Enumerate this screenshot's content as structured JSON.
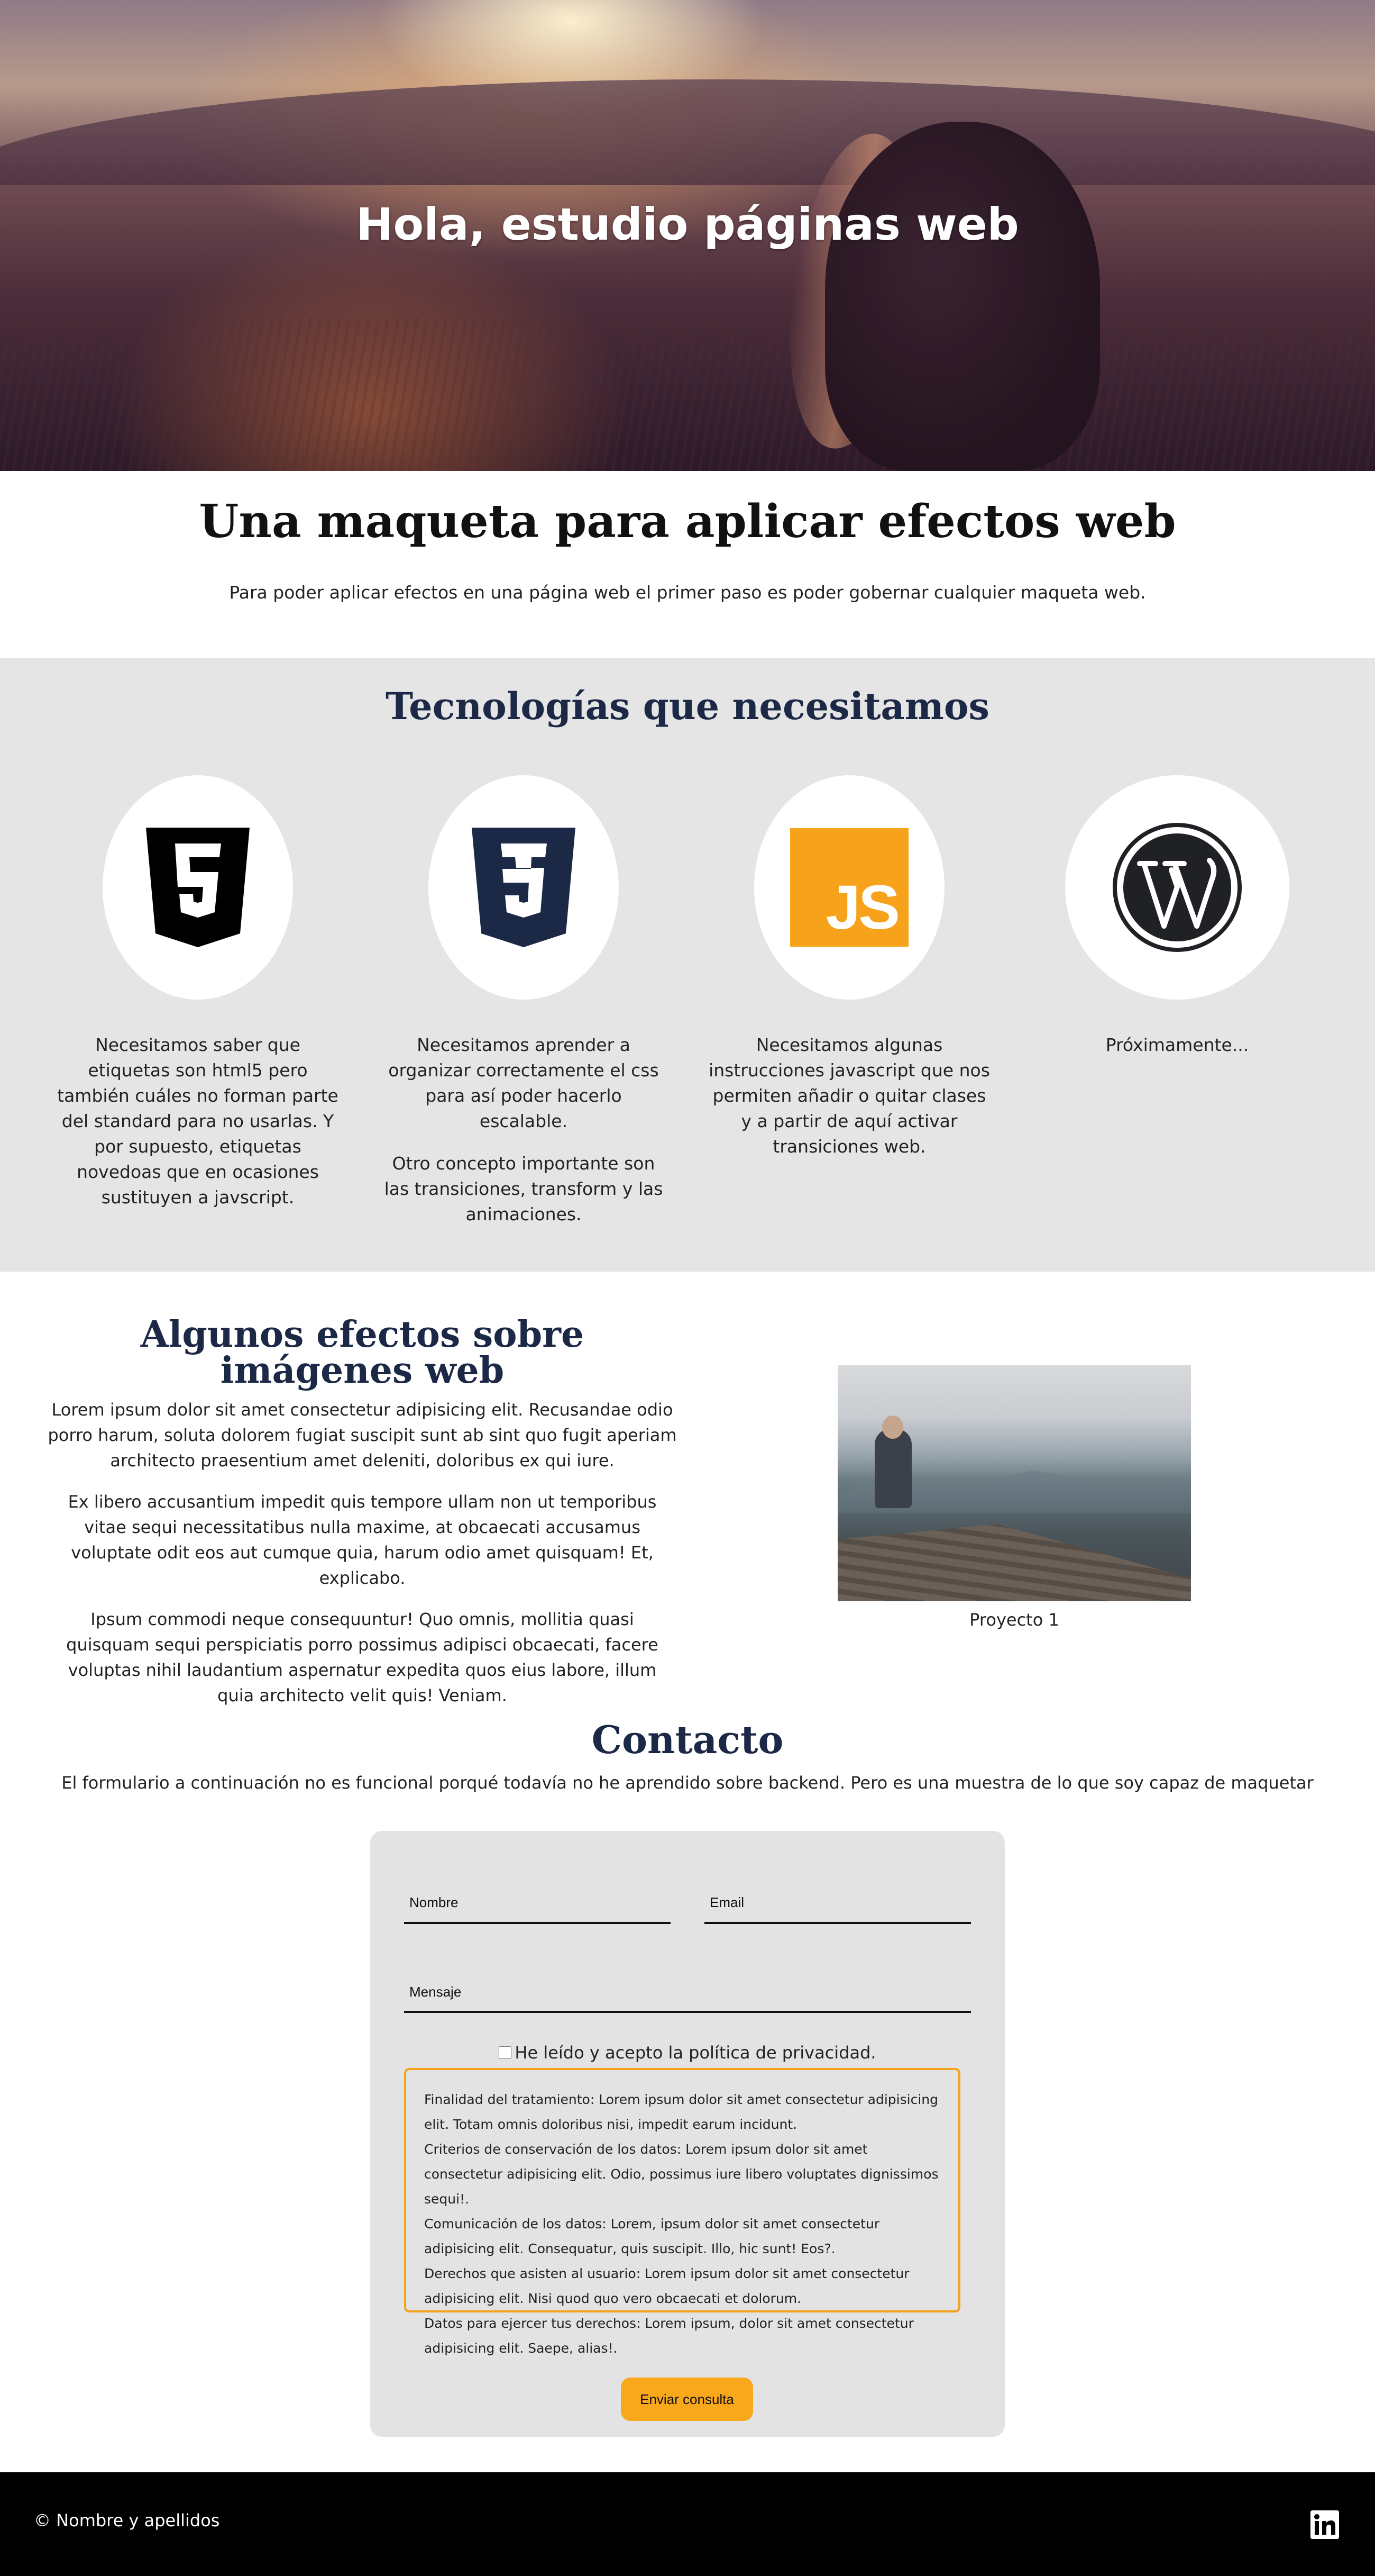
{
  "hero": {
    "title": "Hola, estudio páginas web"
  },
  "intro": {
    "title": "Una maqueta para aplicar efectos web",
    "text": "Para poder aplicar efectos en una página web el primer paso es poder gobernar cualquier maqueta web."
  },
  "tech": {
    "title": "Tecnologías que necesitamos",
    "items": [
      {
        "icon": "html5-icon",
        "color": "#000000",
        "paragraphs": [
          "Necesitamos saber que etiquetas son html5 pero también cuáles no forman parte del standard para no usarlas. Y por supuesto, etiquetas novedoas que en ocasiones sustituyen a javscript."
        ]
      },
      {
        "icon": "css3-icon",
        "color": "#1b2846",
        "paragraphs": [
          "Necesitamos aprender a organizar correctamente el css para así poder hacerlo escalable.",
          "Otro concepto importante son las transiciones, transform y las animaciones."
        ]
      },
      {
        "icon": "javascript-icon",
        "color": "#f7a21b",
        "label": "JS",
        "paragraphs": [
          "Necesitamos algunas instrucciones javascript que nos permiten añadir o quitar clases y a partir de aquí activar transiciones web."
        ]
      },
      {
        "icon": "wordpress-icon",
        "color": "#1f2125",
        "paragraphs": [
          "Próximamente..."
        ]
      }
    ]
  },
  "effects": {
    "title": "Algunos efectos sobre imágenes web",
    "paragraphs": [
      "Lorem ipsum dolor sit amet consectetur adipisicing elit. Recusandae odio porro harum, soluta dolorem fugiat suscipit sunt ab sint quo fugit aperiam architecto praesentium amet deleniti, doloribus ex qui iure.",
      "Ex libero accusantium impedit quis tempore ullam non ut temporibus vitae sequi necessitatibus nulla maxime, at obcaecati accusamus voluptate odit eos aut cumque quia, harum odio amet quisquam! Et, explicabo.",
      "Ipsum commodi neque consequuntur! Quo omnis, mollitia quasi quisquam sequi perspiciatis porro possimus adipisci obcaecati, facere voluptas nihil laudantium aspernatur expedita quos eius labore, illum quia architecto velit quis! Veniam."
    ],
    "project_caption": "Proyecto 1"
  },
  "contact": {
    "title": "Contacto",
    "text": "El formulario a continuación no es funcional porqué todavía no he aprendido sobre backend. Pero es una muestra de lo que soy capaz de maquetar",
    "fields": {
      "nombre": "Nombre",
      "email": "Email",
      "mensaje": "Mensaje"
    },
    "privacy_label": "He leído y acepto la política de privacidad.",
    "policy": [
      "Finalidad del tratamiento: Lorem ipsum dolor sit amet consectetur adipisicing elit. Totam omnis doloribus nisi, impedit earum incidunt.",
      "Criterios de conservación de los datos: Lorem ipsum dolor sit amet consectetur adipisicing elit. Odio, possimus iure libero voluptates dignissimos sequi!.",
      "Comunicación de los datos: Lorem, ipsum dolor sit amet consectetur adipisicing elit. Consequatur, quis suscipit. Illo, hic sunt! Eos?.",
      "Derechos que asisten al usuario: Lorem ipsum dolor sit amet consectetur adipisicing elit. Nisi quod quo vero obcaecati et dolorum.",
      "Datos para ejercer tus derechos: Lorem ipsum, dolor sit amet consectetur adipisicing elit. Saepe, alias!."
    ],
    "submit_label": "Enviar consulta",
    "accent": "#f9a81b"
  },
  "footer": {
    "text": "© Nombre y apellidos",
    "icon": "linkedin-icon"
  }
}
